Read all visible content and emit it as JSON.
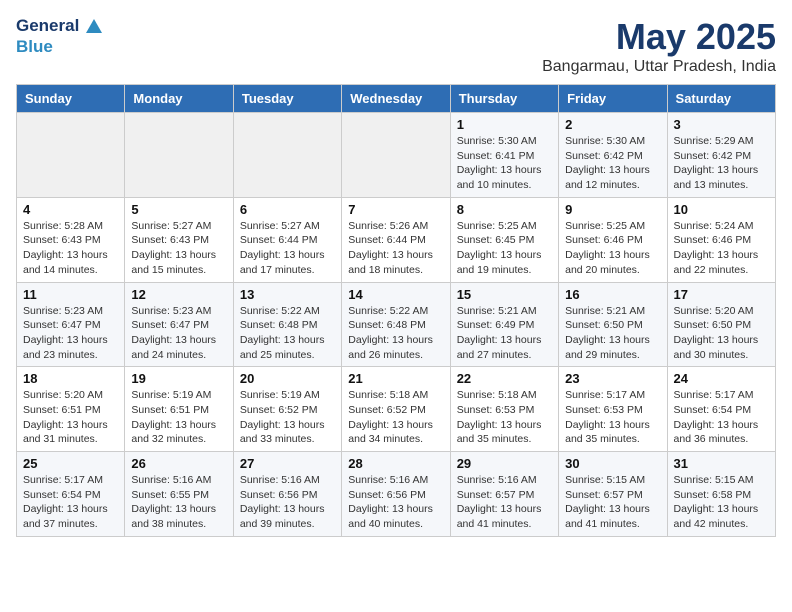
{
  "header": {
    "logo_line1": "General",
    "logo_line2": "Blue",
    "month": "May 2025",
    "location": "Bangarmau, Uttar Pradesh, India"
  },
  "weekdays": [
    "Sunday",
    "Monday",
    "Tuesday",
    "Wednesday",
    "Thursday",
    "Friday",
    "Saturday"
  ],
  "weeks": [
    [
      {
        "day": "",
        "info": ""
      },
      {
        "day": "",
        "info": ""
      },
      {
        "day": "",
        "info": ""
      },
      {
        "day": "",
        "info": ""
      },
      {
        "day": "1",
        "info": "Sunrise: 5:30 AM\nSunset: 6:41 PM\nDaylight: 13 hours\nand 10 minutes."
      },
      {
        "day": "2",
        "info": "Sunrise: 5:30 AM\nSunset: 6:42 PM\nDaylight: 13 hours\nand 12 minutes."
      },
      {
        "day": "3",
        "info": "Sunrise: 5:29 AM\nSunset: 6:42 PM\nDaylight: 13 hours\nand 13 minutes."
      }
    ],
    [
      {
        "day": "4",
        "info": "Sunrise: 5:28 AM\nSunset: 6:43 PM\nDaylight: 13 hours\nand 14 minutes."
      },
      {
        "day": "5",
        "info": "Sunrise: 5:27 AM\nSunset: 6:43 PM\nDaylight: 13 hours\nand 15 minutes."
      },
      {
        "day": "6",
        "info": "Sunrise: 5:27 AM\nSunset: 6:44 PM\nDaylight: 13 hours\nand 17 minutes."
      },
      {
        "day": "7",
        "info": "Sunrise: 5:26 AM\nSunset: 6:44 PM\nDaylight: 13 hours\nand 18 minutes."
      },
      {
        "day": "8",
        "info": "Sunrise: 5:25 AM\nSunset: 6:45 PM\nDaylight: 13 hours\nand 19 minutes."
      },
      {
        "day": "9",
        "info": "Sunrise: 5:25 AM\nSunset: 6:46 PM\nDaylight: 13 hours\nand 20 minutes."
      },
      {
        "day": "10",
        "info": "Sunrise: 5:24 AM\nSunset: 6:46 PM\nDaylight: 13 hours\nand 22 minutes."
      }
    ],
    [
      {
        "day": "11",
        "info": "Sunrise: 5:23 AM\nSunset: 6:47 PM\nDaylight: 13 hours\nand 23 minutes."
      },
      {
        "day": "12",
        "info": "Sunrise: 5:23 AM\nSunset: 6:47 PM\nDaylight: 13 hours\nand 24 minutes."
      },
      {
        "day": "13",
        "info": "Sunrise: 5:22 AM\nSunset: 6:48 PM\nDaylight: 13 hours\nand 25 minutes."
      },
      {
        "day": "14",
        "info": "Sunrise: 5:22 AM\nSunset: 6:48 PM\nDaylight: 13 hours\nand 26 minutes."
      },
      {
        "day": "15",
        "info": "Sunrise: 5:21 AM\nSunset: 6:49 PM\nDaylight: 13 hours\nand 27 minutes."
      },
      {
        "day": "16",
        "info": "Sunrise: 5:21 AM\nSunset: 6:50 PM\nDaylight: 13 hours\nand 29 minutes."
      },
      {
        "day": "17",
        "info": "Sunrise: 5:20 AM\nSunset: 6:50 PM\nDaylight: 13 hours\nand 30 minutes."
      }
    ],
    [
      {
        "day": "18",
        "info": "Sunrise: 5:20 AM\nSunset: 6:51 PM\nDaylight: 13 hours\nand 31 minutes."
      },
      {
        "day": "19",
        "info": "Sunrise: 5:19 AM\nSunset: 6:51 PM\nDaylight: 13 hours\nand 32 minutes."
      },
      {
        "day": "20",
        "info": "Sunrise: 5:19 AM\nSunset: 6:52 PM\nDaylight: 13 hours\nand 33 minutes."
      },
      {
        "day": "21",
        "info": "Sunrise: 5:18 AM\nSunset: 6:52 PM\nDaylight: 13 hours\nand 34 minutes."
      },
      {
        "day": "22",
        "info": "Sunrise: 5:18 AM\nSunset: 6:53 PM\nDaylight: 13 hours\nand 35 minutes."
      },
      {
        "day": "23",
        "info": "Sunrise: 5:17 AM\nSunset: 6:53 PM\nDaylight: 13 hours\nand 35 minutes."
      },
      {
        "day": "24",
        "info": "Sunrise: 5:17 AM\nSunset: 6:54 PM\nDaylight: 13 hours\nand 36 minutes."
      }
    ],
    [
      {
        "day": "25",
        "info": "Sunrise: 5:17 AM\nSunset: 6:54 PM\nDaylight: 13 hours\nand 37 minutes."
      },
      {
        "day": "26",
        "info": "Sunrise: 5:16 AM\nSunset: 6:55 PM\nDaylight: 13 hours\nand 38 minutes."
      },
      {
        "day": "27",
        "info": "Sunrise: 5:16 AM\nSunset: 6:56 PM\nDaylight: 13 hours\nand 39 minutes."
      },
      {
        "day": "28",
        "info": "Sunrise: 5:16 AM\nSunset: 6:56 PM\nDaylight: 13 hours\nand 40 minutes."
      },
      {
        "day": "29",
        "info": "Sunrise: 5:16 AM\nSunset: 6:57 PM\nDaylight: 13 hours\nand 41 minutes."
      },
      {
        "day": "30",
        "info": "Sunrise: 5:15 AM\nSunset: 6:57 PM\nDaylight: 13 hours\nand 41 minutes."
      },
      {
        "day": "31",
        "info": "Sunrise: 5:15 AM\nSunset: 6:58 PM\nDaylight: 13 hours\nand 42 minutes."
      }
    ]
  ]
}
